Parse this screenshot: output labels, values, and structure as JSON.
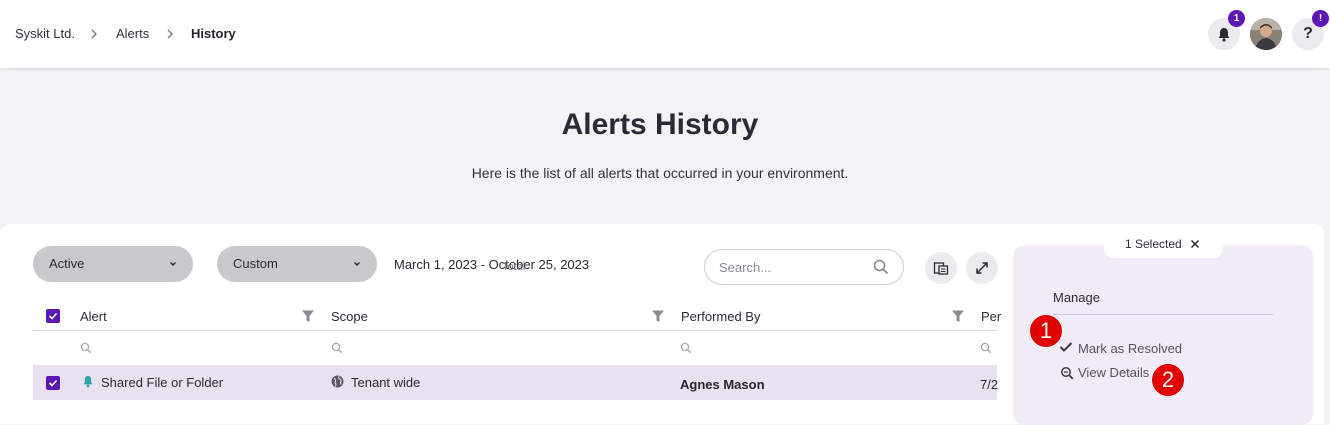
{
  "breadcrumb": {
    "items": [
      "Syskit Ltd.",
      "Alerts"
    ],
    "current": "History"
  },
  "header": {
    "notifications_badge": "1",
    "help_badge": "!",
    "help_label": "?"
  },
  "page": {
    "title": "Alerts History",
    "subtitle": "Here is the list of all alerts that occurred in your environment."
  },
  "filters": {
    "status_dropdown": "Active",
    "period_dropdown": "Custom",
    "date_range": "March 1, 2023 - October 25, 2023",
    "total_label": "Total"
  },
  "search": {
    "placeholder": "Search...",
    "value": ""
  },
  "table": {
    "columns": [
      "Alert",
      "Scope",
      "Performed By",
      "Per"
    ],
    "rows": [
      {
        "alert": "Shared File or Folder",
        "scope": "Tenant wide",
        "performed_by": "Agnes Mason",
        "performed_on": "7/2",
        "selected": true
      }
    ]
  },
  "side_panel": {
    "selected_label": "1 Selected",
    "manage_title": "Manage",
    "actions": [
      "Mark as Resolved",
      "View Details"
    ]
  },
  "annotations": [
    "1",
    "2"
  ],
  "colors": {
    "accent": "#5b18b8",
    "row_selected": "#e9e0f0",
    "panel_bg": "#f1eaf7",
    "marker_red": "#e30000",
    "icon_teal": "#2aa6a6"
  }
}
